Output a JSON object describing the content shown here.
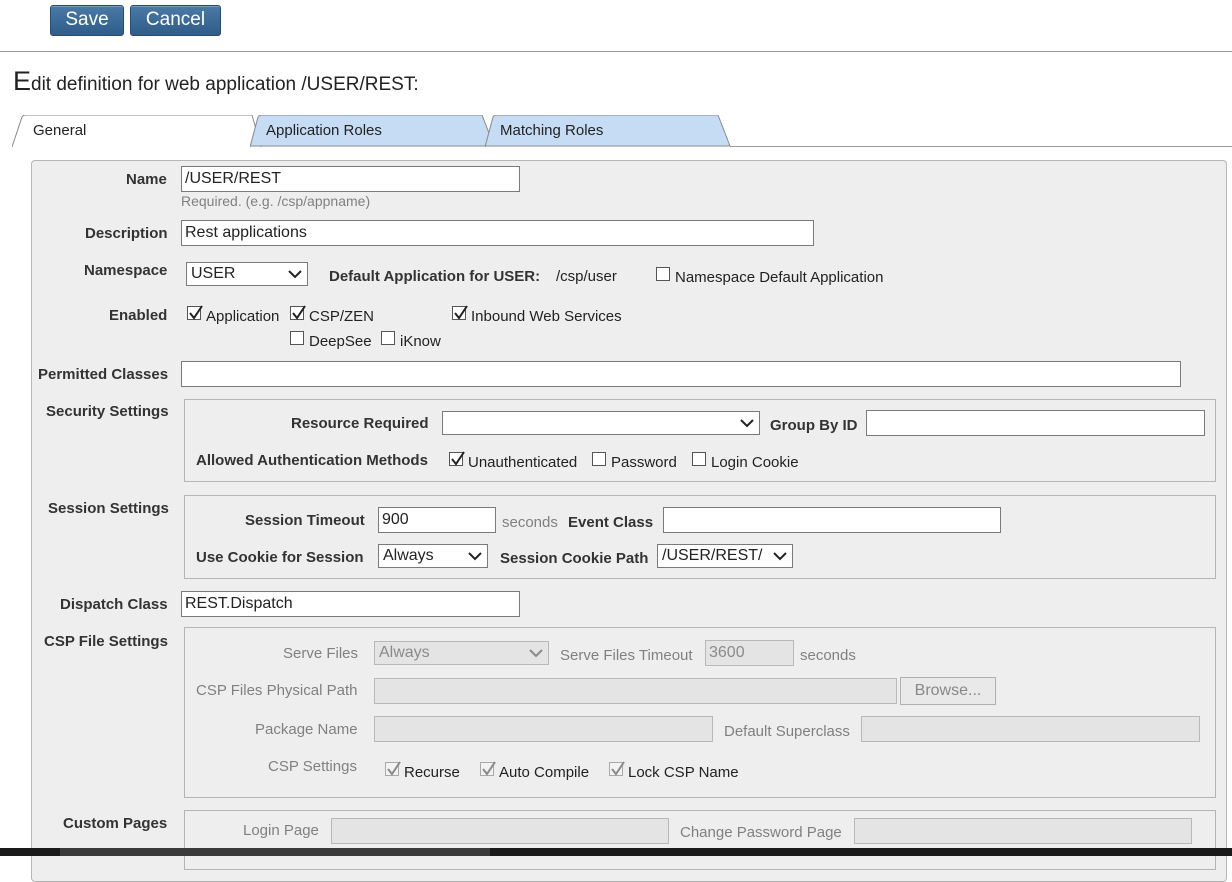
{
  "toolbar": {
    "save_label": "Save",
    "cancel_label": "Cancel"
  },
  "page": {
    "title_first": "E",
    "title_rest": "dit definition for web application /USER/REST:"
  },
  "tabs": [
    {
      "label": "General",
      "active": true
    },
    {
      "label": "Application Roles",
      "active": false
    },
    {
      "label": "Matching Roles",
      "active": false
    }
  ],
  "form": {
    "name": {
      "label": "Name",
      "value": "/USER/REST",
      "hint": "Required. (e.g. /csp/appname)"
    },
    "description": {
      "label": "Description",
      "value": "Rest applications"
    },
    "namespace": {
      "label": "Namespace",
      "value": "USER",
      "default_app_label": "Default Application for USER:",
      "default_app_value": "/csp/user",
      "ns_default_label": "Namespace Default Application",
      "ns_default_checked": false
    },
    "enabled": {
      "label": "Enabled",
      "options": [
        {
          "label": "Application",
          "checked": true
        },
        {
          "label": "CSP/ZEN",
          "checked": true
        },
        {
          "label": "Inbound Web Services",
          "checked": true
        },
        {
          "label": "DeepSee",
          "checked": false
        },
        {
          "label": "iKnow",
          "checked": false
        }
      ]
    },
    "permitted_classes": {
      "label": "Permitted Classes",
      "value": ""
    },
    "security": {
      "label": "Security Settings",
      "resource_required_label": "Resource Required",
      "resource_required_value": "",
      "group_by_id_label": "Group By ID",
      "group_by_id_value": "",
      "auth_methods_label": "Allowed Authentication Methods",
      "auth_methods": [
        {
          "label": "Unauthenticated",
          "checked": true
        },
        {
          "label": "Password",
          "checked": false
        },
        {
          "label": "Login Cookie",
          "checked": false
        }
      ]
    },
    "session": {
      "label": "Session Settings",
      "timeout_label": "Session Timeout",
      "timeout_value": "900",
      "timeout_unit": "seconds",
      "event_class_label": "Event Class",
      "event_class_value": "",
      "use_cookie_label": "Use Cookie for Session",
      "use_cookie_value": "Always",
      "cookie_path_label": "Session Cookie Path",
      "cookie_path_value": "/USER/REST/"
    },
    "dispatch_class": {
      "label": "Dispatch Class",
      "value": "REST.Dispatch"
    },
    "csp_files": {
      "label": "CSP File Settings",
      "serve_files_label": "Serve Files",
      "serve_files_value": "Always",
      "serve_timeout_label": "Serve Files Timeout",
      "serve_timeout_value": "3600",
      "serve_timeout_unit": "seconds",
      "physical_path_label": "CSP Files Physical Path",
      "physical_path_value": "",
      "browse_label": "Browse...",
      "package_name_label": "Package Name",
      "package_name_value": "",
      "default_superclass_label": "Default Superclass",
      "default_superclass_value": "",
      "csp_settings_label": "CSP Settings",
      "csp_settings": [
        {
          "label": "Recurse",
          "checked": true
        },
        {
          "label": "Auto Compile",
          "checked": true
        },
        {
          "label": "Lock CSP Name",
          "checked": true
        }
      ]
    },
    "custom_pages": {
      "label": "Custom Pages",
      "login_page_label": "Login Page",
      "login_page_value": "",
      "change_password_label": "Change Password Page",
      "change_password_value": ""
    }
  }
}
